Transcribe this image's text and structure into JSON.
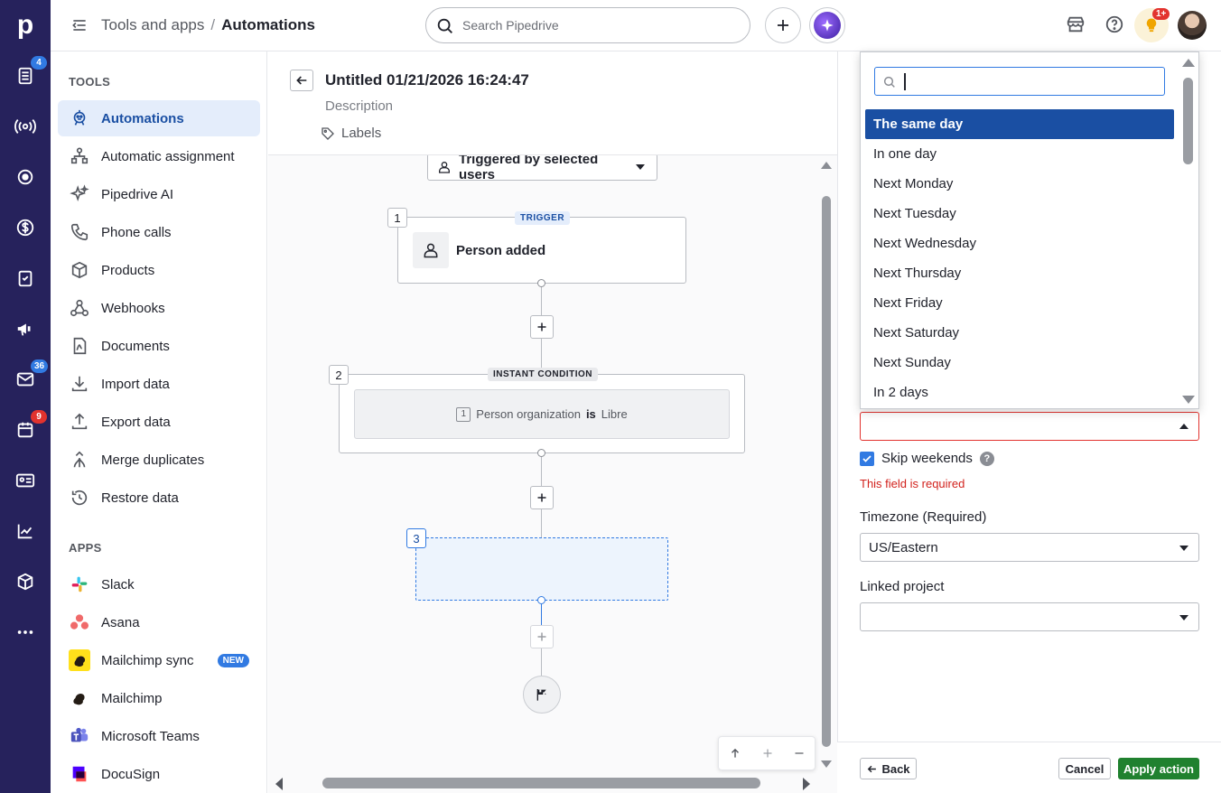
{
  "rail": {
    "logo": "p",
    "badges": {
      "leads": "4",
      "mail": "36",
      "calendar": "9"
    },
    "colors": {
      "bg": "#26225c"
    }
  },
  "topbar": {
    "breadcrumb_parent": "Tools and apps",
    "breadcrumb_separator": "/",
    "breadcrumb_current": "Automations",
    "search_placeholder": "Search Pipedrive",
    "notif_badge": "1+"
  },
  "sidebar": {
    "tools_title": "TOOLS",
    "tools": [
      {
        "label": "Automations",
        "icon": "robot-icon",
        "active": true
      },
      {
        "label": "Automatic assignment",
        "icon": "assignment-icon"
      },
      {
        "label": "Pipedrive AI",
        "icon": "sparkle-icon"
      },
      {
        "label": "Phone calls",
        "icon": "phone-icon"
      },
      {
        "label": "Products",
        "icon": "box-icon"
      },
      {
        "label": "Webhooks",
        "icon": "webhook-icon"
      },
      {
        "label": "Documents",
        "icon": "document-icon"
      },
      {
        "label": "Import data",
        "icon": "download-icon"
      },
      {
        "label": "Export data",
        "icon": "upload-icon"
      },
      {
        "label": "Merge duplicates",
        "icon": "merge-icon"
      },
      {
        "label": "Restore data",
        "icon": "restore-icon"
      }
    ],
    "apps_title": "APPS",
    "apps": [
      {
        "label": "Slack",
        "icon": "slack-icon"
      },
      {
        "label": "Asana",
        "icon": "asana-icon"
      },
      {
        "label": "Mailchimp sync",
        "icon": "mailchimp-icon",
        "badge": "NEW"
      },
      {
        "label": "Mailchimp",
        "icon": "mailchimp-icon"
      },
      {
        "label": "Microsoft Teams",
        "icon": "teams-icon"
      },
      {
        "label": "DocuSign",
        "icon": "docusign-icon"
      }
    ]
  },
  "editor": {
    "title": "Untitled 01/21/2026 16:24:47",
    "description": "Description",
    "labels": "Labels",
    "trigger_select": "Triggered by selected users",
    "nodes": {
      "n1_num": "1",
      "n1_tag": "TRIGGER",
      "n1_label": "Person added",
      "n2_num": "2",
      "n2_tag": "INSTANT CONDITION",
      "n2_cond_ref": "1",
      "n2_cond_field": "Person organization",
      "n2_cond_op": "is",
      "n2_cond_value": "Libre",
      "n3_num": "3"
    }
  },
  "panel": {
    "skip_weekends": "Skip weekends",
    "skip_weekends_checked": true,
    "error": "This field is required",
    "timezone_label": "Timezone (Required)",
    "timezone_value": "US/Eastern",
    "linked_project_label": "Linked project",
    "linked_project_value": "",
    "back": "Back",
    "cancel": "Cancel",
    "apply": "Apply action",
    "colors": {
      "apply": "#20812f",
      "error": "#e2332e",
      "selected": "#1a4fa3"
    }
  },
  "dropdown": {
    "search_value": "",
    "options": [
      "The same day",
      "In one day",
      "Next Monday",
      "Next Tuesday",
      "Next Wednesday",
      "Next Thursday",
      "Next Friday",
      "Next Saturday",
      "Next Sunday",
      "In 2 days"
    ],
    "selected_index": 0
  }
}
